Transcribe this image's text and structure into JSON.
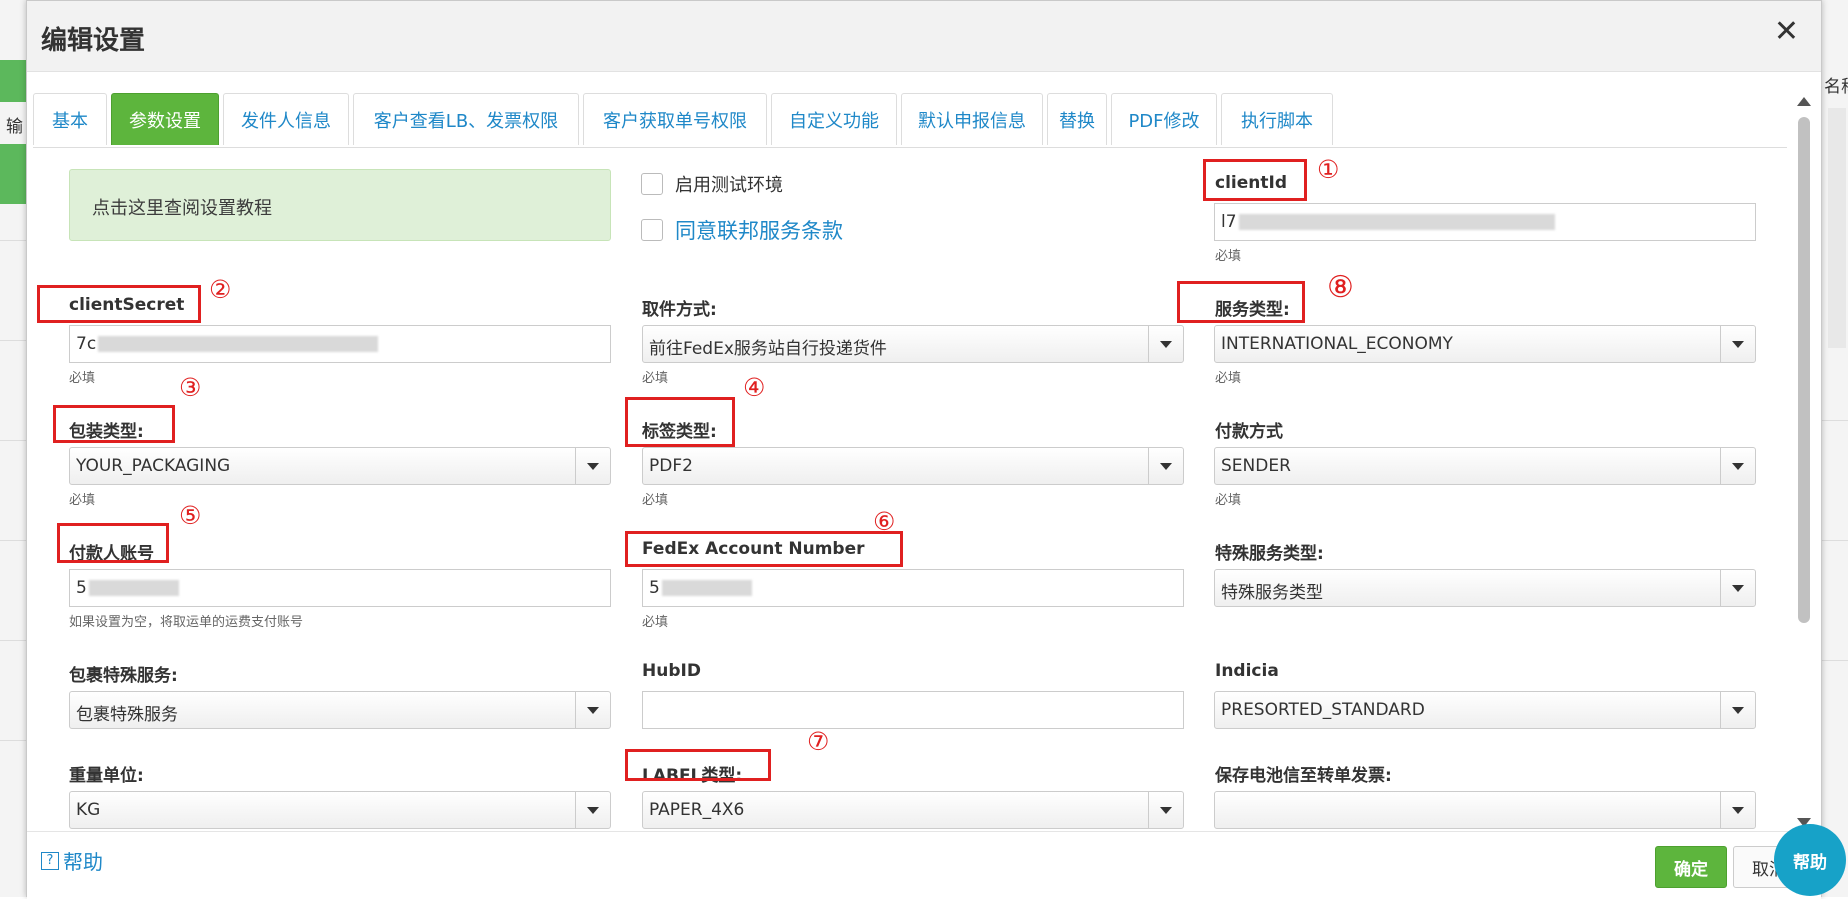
{
  "dialog": {
    "title": "编辑设置",
    "close_icon": "close-icon",
    "tabs": [
      {
        "label": "基本",
        "active": false
      },
      {
        "label": "参数设置",
        "active": true
      },
      {
        "label": "发件人信息",
        "active": false
      },
      {
        "label": "客户查看LB、发票权限",
        "active": false
      },
      {
        "label": "客户获取单号权限",
        "active": false
      },
      {
        "label": "自定义功能",
        "active": false
      },
      {
        "label": "默认申报信息",
        "active": false
      },
      {
        "label": "替换",
        "active": false
      },
      {
        "label": "PDF修改",
        "active": false
      },
      {
        "label": "执行脚本",
        "active": false
      }
    ]
  },
  "background_page": {
    "left_text": "输",
    "right_text": "名称"
  },
  "form": {
    "tutorial_text": "点击这里查阅设置教程",
    "test_env_label": "启用测试环境",
    "agree_terms_label": "同意联邦服务条款",
    "required_text": "必填",
    "client_id": {
      "label": "clientId",
      "value_prefix": "l7"
    },
    "client_secret": {
      "label": "clientSecret",
      "value_prefix": "7c"
    },
    "pickup": {
      "label": "取件方式:",
      "value": "前往FedEx服务站自行投递货件"
    },
    "service_type": {
      "label": "服务类型:",
      "value": "INTERNATIONAL_ECONOMY"
    },
    "package_type": {
      "label": "包装类型:",
      "value": "YOUR_PACKAGING"
    },
    "label_type": {
      "label": "标签类型:",
      "value": "PDF2"
    },
    "payment": {
      "label": "付款方式",
      "value": "SENDER"
    },
    "payer_account": {
      "label": "付款人账号",
      "value_prefix": "5",
      "hint": "如果设置为空，将取运单的运费支付账号"
    },
    "fedex_account": {
      "label": "FedEx Account Number",
      "value_prefix": "5"
    },
    "special_service": {
      "label": "特殊服务类型:",
      "value": "特殊服务类型"
    },
    "package_special": {
      "label": "包裹特殊服务:",
      "value": "包裹特殊服务"
    },
    "hub_id": {
      "label": "HubID",
      "value": ""
    },
    "indicia": {
      "label": "Indicia",
      "value": "PRESORTED_STANDARD"
    },
    "weight_unit": {
      "label": "重量单位:",
      "value": "KG"
    },
    "label_format": {
      "label": "LABEL类型:",
      "value": "PAPER_4X6"
    },
    "battery_invoice": {
      "label": "保存电池信至转单发票:",
      "value": ""
    }
  },
  "annotations": [
    "①",
    "②",
    "③",
    "④",
    "⑤",
    "⑥",
    "⑦",
    "⑧"
  ],
  "annotation_color": "#e02020",
  "accent_color": "#5db53d",
  "link_color": "#1f88c8",
  "footer": {
    "help_label": "帮助",
    "help_icon": "?",
    "ok_label": "确定",
    "cancel_label": "取消",
    "float_help_label": "帮助"
  }
}
